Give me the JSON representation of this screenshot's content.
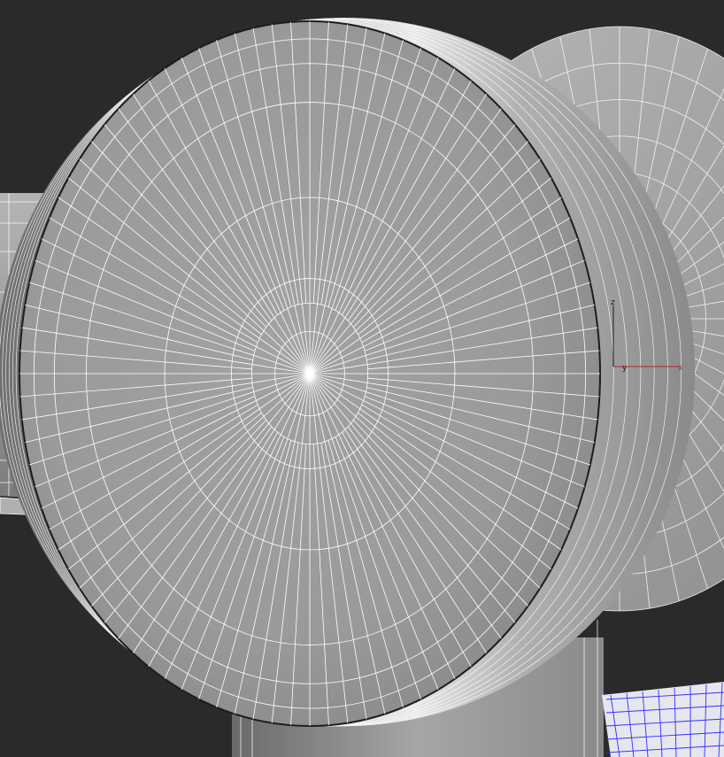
{
  "viewport": {
    "background_color": "#2a2a2a",
    "mesh_color": "#9a9a9a",
    "wire_color": "#ffffff",
    "selected_wire_color": "#3030ff"
  },
  "gizmo": {
    "z_label": "z",
    "y_label": "y",
    "x_label": "x",
    "z_color": "#1a1a1a",
    "y_color": "#1a1a1a",
    "x_color": "#c02030"
  }
}
